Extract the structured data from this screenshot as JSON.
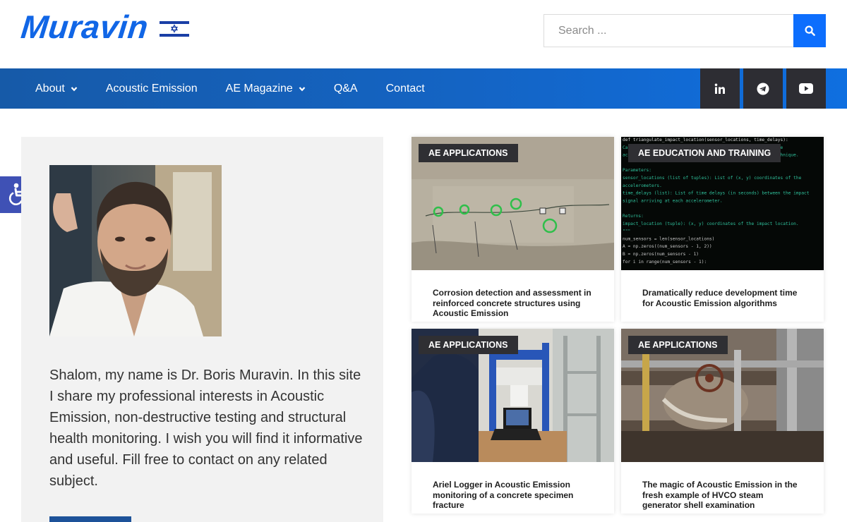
{
  "site": {
    "logo_text": "Muravin",
    "brand_color": "#1166e6"
  },
  "search": {
    "placeholder": "Search ...",
    "value": "",
    "icon": "search-icon"
  },
  "nav": {
    "items": [
      {
        "label": "About",
        "has_dropdown": true
      },
      {
        "label": "Acoustic Emission",
        "has_dropdown": false
      },
      {
        "label": "AE Magazine",
        "has_dropdown": true
      },
      {
        "label": "Q&A",
        "has_dropdown": false
      },
      {
        "label": "Contact",
        "has_dropdown": false
      }
    ],
    "social": [
      "linkedin-icon",
      "telegram-icon",
      "youtube-icon"
    ]
  },
  "intro": {
    "text": "Shalom, my name is Dr. Boris Muravin. In this site I share my professional interests in Acoustic Emission, non-destructive testing and structural health monitoring. I wish you will find it informative and useful. Fill free to contact on any related subject."
  },
  "accessibility": {
    "icon": "wheelchair-icon"
  },
  "cards": [
    {
      "tag": "AE Applications",
      "title": "Corrosion detection and assessment in reinforced concrete structures using Acoustic Emission"
    },
    {
      "tag": "AE Education and Training",
      "title": "Dramatically reduce development time for Acoustic Emission algorithms"
    },
    {
      "tag": "AE Applications",
      "title": "Ariel Logger in Acoustic Emission monitoring of a concrete specimen fracture"
    },
    {
      "tag": "AE Applications",
      "title": "The magic of Acoustic Emission in the fresh example of HVCO steam generator shell examination"
    }
  ],
  "code_snippet": [
    "def triangulate_impact_location(sensor_locations, time_delays):",
    "    Calculate the location of an impact on a plate using multiple",
    "    accelerometers and the time difference of arrival (TDOA) technique.",
    "",
    "    Parameters:",
    "    sensor_locations (list of tuples): List of (x, y) coordinates of the",
    "        accelerometers.",
    "    time_delays (list): List of time delays (in seconds) between the impact",
    "        signal arriving at each accelerometer.",
    "",
    "    Returns:",
    "    impact_location (tuple): (x, y) coordinates of the impact location.",
    "    \"\"\"",
    "    num_sensors = len(sensor_locations)",
    "    A = np.zeros((num_sensors - 1, 2))",
    "    B = np.zeros(num_sensors - 1)",
    "    for i in range(num_sensors - 1):"
  ]
}
